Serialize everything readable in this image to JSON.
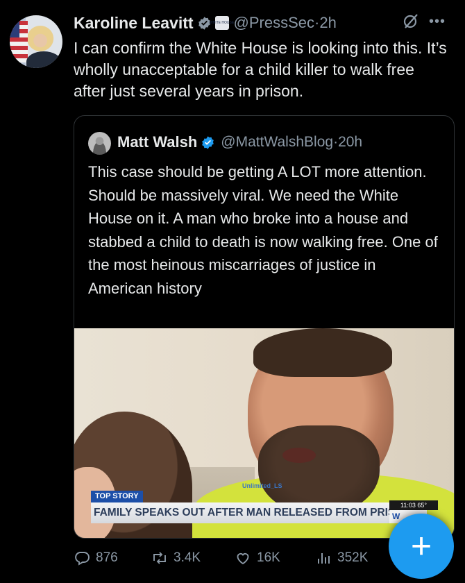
{
  "post": {
    "author_name": "Karoline Leavitt",
    "handle": "@PressSec",
    "time": "2h",
    "text": "I can confirm the White House is looking into this. It’s wholly unacceptable for a child killer to walk free after just several years in prison.",
    "affiliation_badge_text": "WHITE HOUSE"
  },
  "quote": {
    "author_name": "Matt Walsh",
    "handle": "@MattWalshBlog",
    "time": "20h",
    "text": "This case should be getting A LOT more attention. Should be massively viral. We need the White House on it. A man who broke into a house and stabbed a child to death is now walking free. One of the most heinous miscarriages of justice in American history",
    "media": {
      "tag": "TOP STORY",
      "headline": "FAMILY SPEAKS OUT AFTER MAN RELEASED FROM PRISON",
      "clock": "11:03  65°",
      "channel_logo": "W",
      "watermark": "Unlimited_LS"
    }
  },
  "actions": {
    "replies": "876",
    "reposts": "3.4K",
    "likes": "16K",
    "views": "352K"
  },
  "fab": {
    "icon": "plus-icon",
    "label": "+"
  },
  "colors": {
    "background": "#000000",
    "text": "#e7e9ea",
    "secondary": "#8b98a5",
    "accent": "#1d9bf0",
    "border": "#2f3336"
  }
}
